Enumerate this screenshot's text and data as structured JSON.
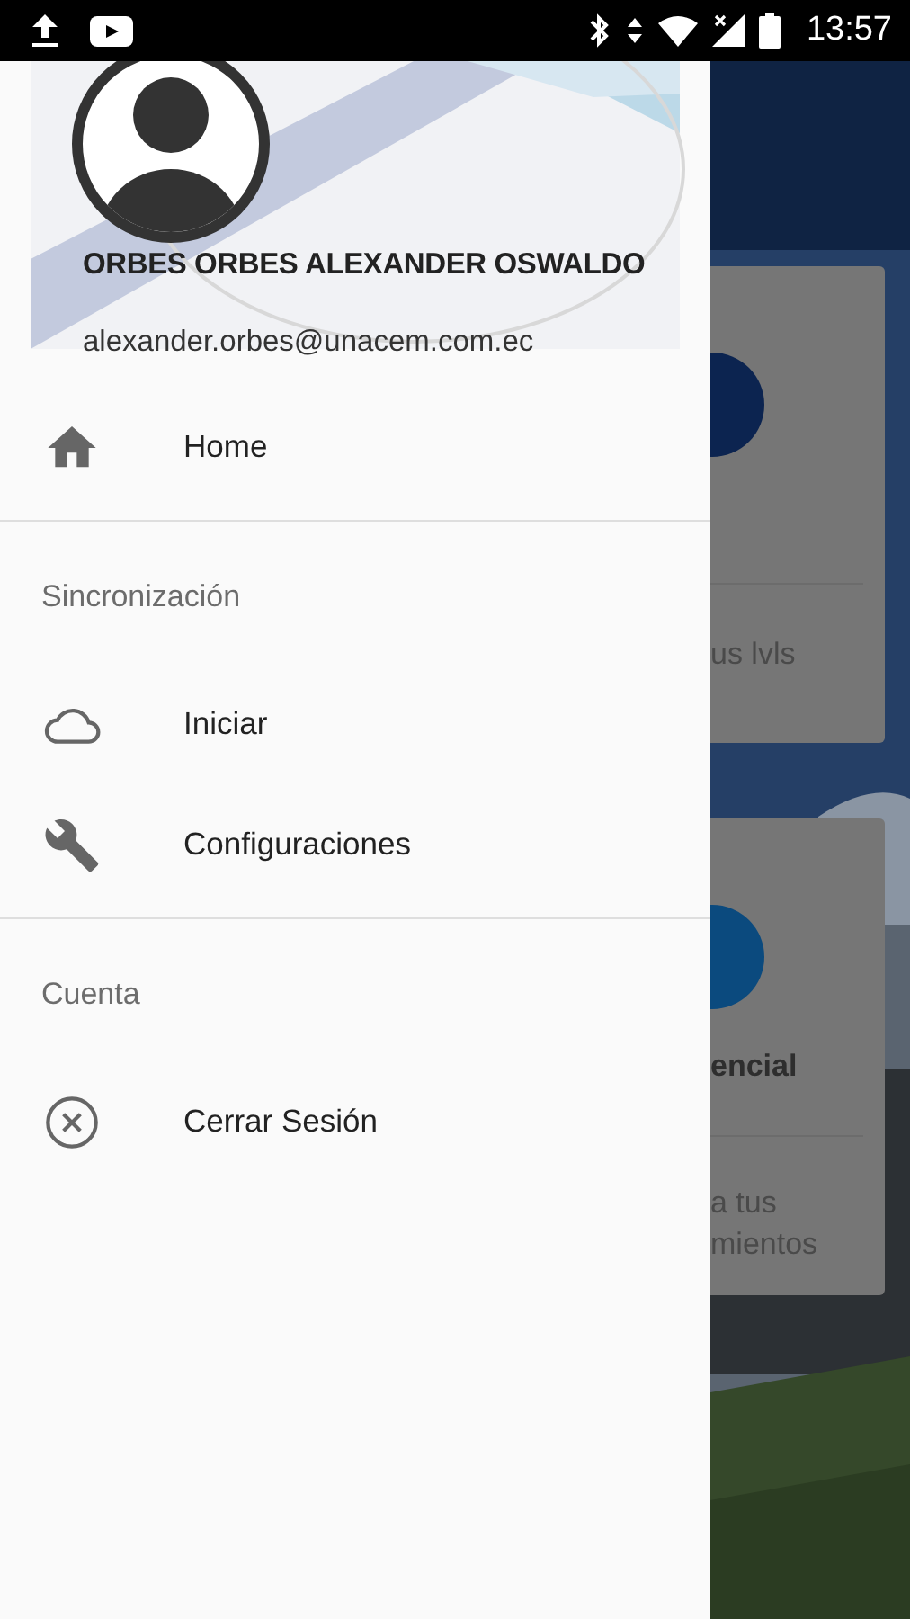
{
  "status_bar": {
    "time": "13:57"
  },
  "drawer": {
    "user": {
      "name": "ORBES ORBES ALEXANDER OSWALDO",
      "email": "alexander.orbes@unacem.com.ec"
    },
    "sections": [
      {
        "items": [
          {
            "label": "Home",
            "kind": "home"
          }
        ]
      },
      {
        "title": "Sincronización",
        "items": [
          {
            "label": "Iniciar",
            "kind": "cloud"
          },
          {
            "label": "Configuraciones",
            "kind": "wrench"
          }
        ]
      },
      {
        "title": "Cuenta",
        "items": [
          {
            "label": "Cerrar Sesión",
            "kind": "close"
          }
        ]
      }
    ]
  },
  "background_cards": [
    {
      "color": "#0c2450",
      "lines": [
        "us lvls"
      ]
    },
    {
      "color": "#0b4a7e",
      "title": "encial",
      "lines": [
        "a tus",
        "mientos"
      ]
    }
  ]
}
